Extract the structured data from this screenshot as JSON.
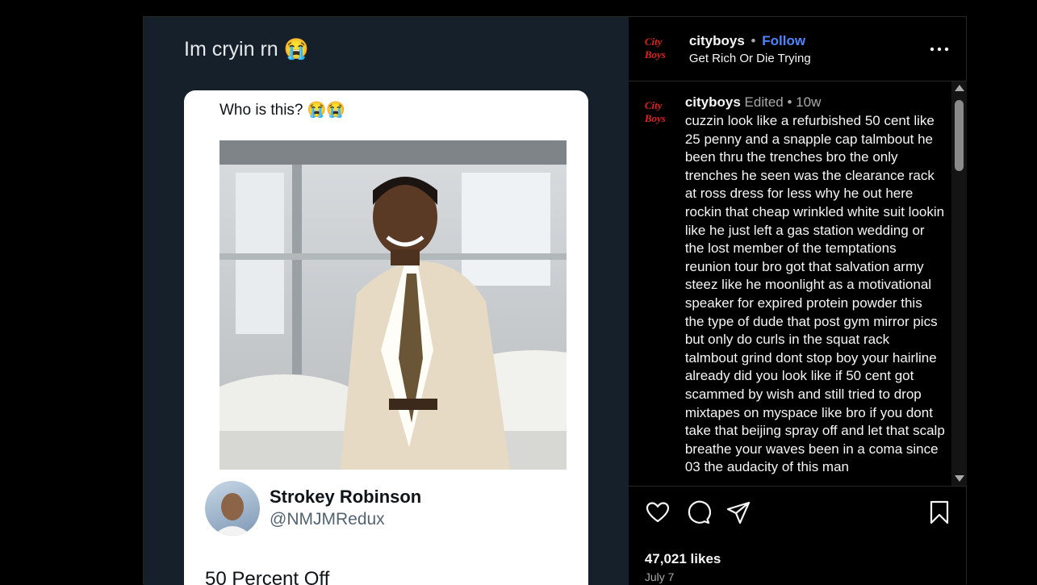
{
  "post": {
    "overlay_caption": "Im cryin rn 😭",
    "tweet": {
      "question": "Who is this? 😭😭",
      "author_name": "Strokey Robinson",
      "author_handle": "@NMJMRedux",
      "text": "50 Percent Off"
    }
  },
  "header": {
    "logo_text": "City Boys",
    "username": "cityboys",
    "separator": "•",
    "follow_label": "Follow",
    "subtitle": "Get Rich Or Die Trying",
    "more_icon": "more-horizontal-icon"
  },
  "comment": {
    "username": "cityboys",
    "edited_label": "Edited",
    "separator": "•",
    "age": "10w",
    "text": "cuzzin look like a refurbished 50 cent like 25 penny and a snapple cap talmbout he been thru the trenches bro the only trenches he seen was the clearance rack at ross dress for less why he out here rockin that cheap wrinkled white suit lookin like he just left a gas station wedding or the lost member of the temptations reunion tour bro got that salvation army steez like he moonlight as a motivational speaker for expired protein powder this the type of dude that post gym mirror pics but only do curls in the squat rack talmbout grind dont stop boy your hairline already did you look like if 50 cent got scammed by wish and still tried to drop mixtapes on myspace like bro if you dont take that beijing spray off and let that scalp breathe your waves been in a coma since 03 the audacity of this man"
  },
  "actions": {
    "icons": [
      "heart-icon",
      "comment-icon",
      "share-icon",
      "bookmark-icon"
    ],
    "likes": "47,021 likes",
    "date": "July 7"
  },
  "colors": {
    "background": "#000000",
    "media_background": "#15202b",
    "follow": "#4f84ff",
    "muted": "#a8a8a8",
    "logo": "#dd2222"
  }
}
